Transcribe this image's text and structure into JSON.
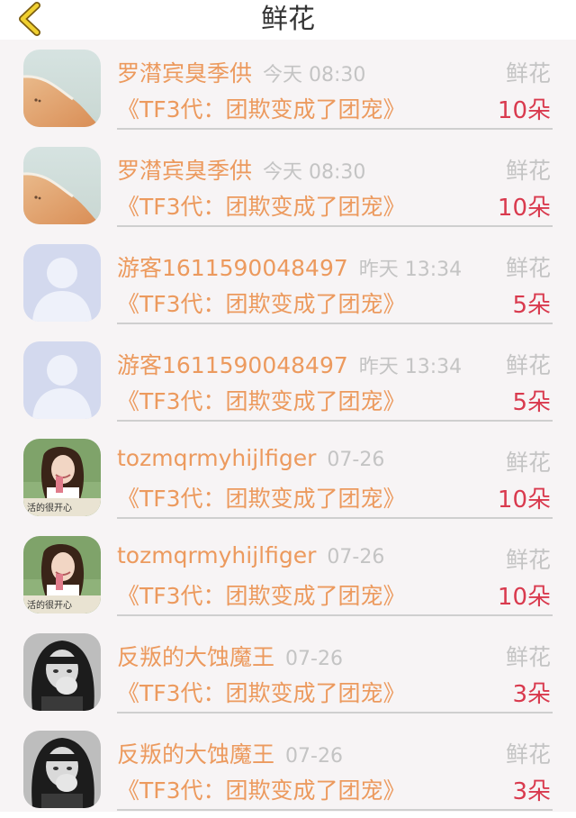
{
  "header": {
    "title": "鲜花"
  },
  "icons": {
    "back": "chevron-left-icon",
    "back_color": "#e0c020"
  },
  "colors": {
    "name": "#ec9a5e",
    "meta": "#c4c4c4",
    "amount": "#d93a4e",
    "list_bg": "#f7f4f5"
  },
  "items": [
    {
      "name": "罗潸宾臭季供",
      "time": "今天 08:30",
      "book": "《TF3代：团欺变成了团宠》",
      "type": "鲜花",
      "amount": "10朵",
      "avatar": "beach"
    },
    {
      "name": "罗潸宾臭季供",
      "time": "今天 08:30",
      "book": "《TF3代：团欺变成了团宠》",
      "type": "鲜花",
      "amount": "10朵",
      "avatar": "beach"
    },
    {
      "name": "游客1611590048497",
      "time": "昨天 13:34",
      "book": "《TF3代：团欺变成了团宠》",
      "type": "鲜花",
      "amount": "5朵",
      "avatar": "default"
    },
    {
      "name": "游客1611590048497",
      "time": "昨天 13:34",
      "book": "《TF3代：团欺变成了团宠》",
      "type": "鲜花",
      "amount": "5朵",
      "avatar": "default"
    },
    {
      "name": "tozmqrmyhijlfiger",
      "time": "07-26",
      "book": "《TF3代：团欺变成了团宠》",
      "type": "鲜花",
      "amount": "10朵",
      "avatar": "girl",
      "avatar_caption": "活的很开心"
    },
    {
      "name": "tozmqrmyhijlfiger",
      "time": "07-26",
      "book": "《TF3代：团欺变成了团宠》",
      "type": "鲜花",
      "amount": "10朵",
      "avatar": "girl",
      "avatar_caption": "活的很开心"
    },
    {
      "name": "反叛的大蚀魔王",
      "time": "07-26",
      "book": "《TF3代：团欺变成了团宠》",
      "type": "鲜花",
      "amount": "3朵",
      "avatar": "bw"
    },
    {
      "name": "反叛的大蚀魔王",
      "time": "07-26",
      "book": "《TF3代：团欺变成了团宠》",
      "type": "鲜花",
      "amount": "3朵",
      "avatar": "bw"
    }
  ]
}
